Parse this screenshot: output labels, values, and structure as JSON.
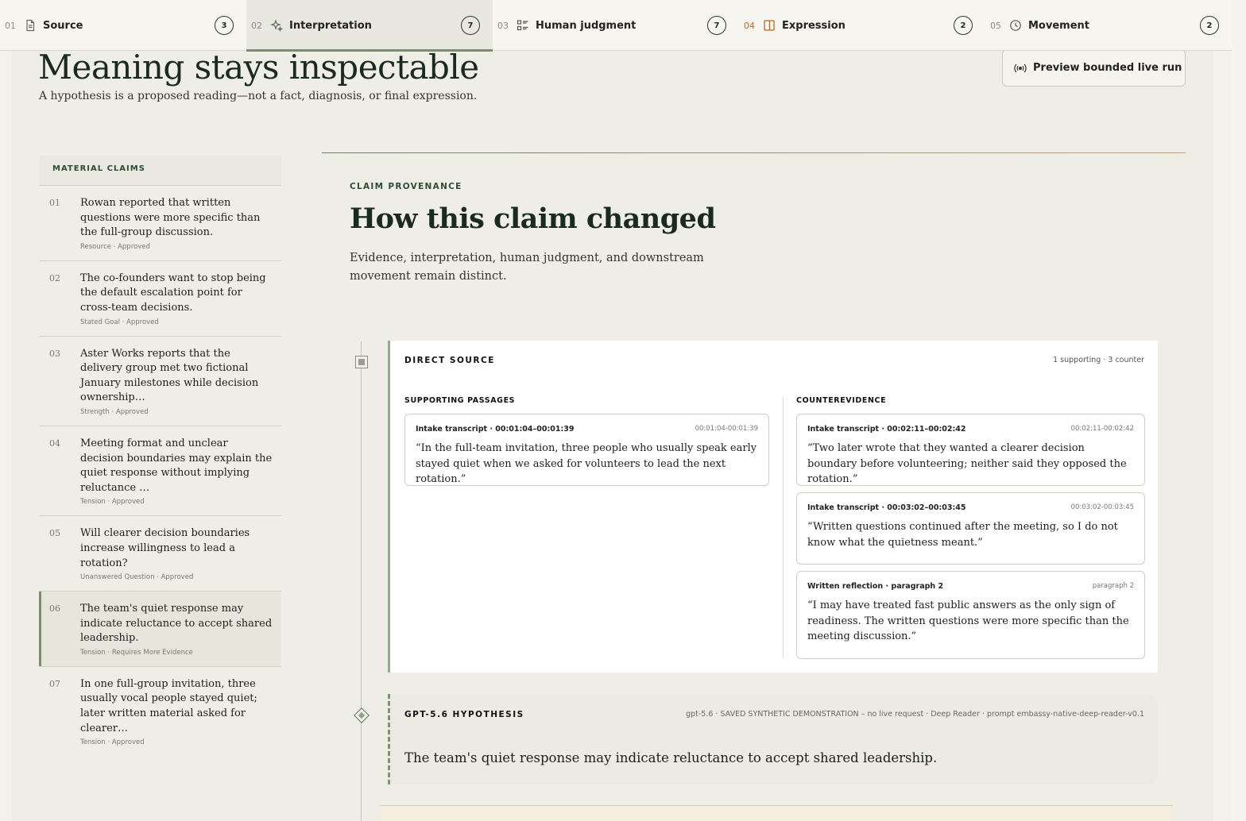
{
  "tabs": [
    {
      "num": "01",
      "label": "Source",
      "count": "3",
      "icon": "document-icon",
      "active": false
    },
    {
      "num": "02",
      "label": "Interpretation",
      "count": "7",
      "icon": "sparkle-icon",
      "active": true
    },
    {
      "num": "03",
      "label": "Human judgment",
      "count": "7",
      "icon": "checklist-icon",
      "active": false
    },
    {
      "num": "04",
      "label": "Expression",
      "count": "2",
      "icon": "panel-icon",
      "active": false
    },
    {
      "num": "05",
      "label": "Movement",
      "count": "2",
      "icon": "clock-icon",
      "active": false
    }
  ],
  "header": {
    "title": "Meaning stays inspectable",
    "subtitle": "A hypothesis is a proposed reading—not a fact, diagnosis, or final expression.",
    "preview_button": "Preview bounded live run"
  },
  "claims": {
    "heading": "MATERIAL CLAIMS",
    "items": [
      {
        "num": "01",
        "text": "Rowan reported that written questions were more specific than the full-group discussion.",
        "meta": "Resource · Approved"
      },
      {
        "num": "02",
        "text": "The co-founders want to stop being the default escalation point for cross-team decisions.",
        "meta": "Stated Goal · Approved"
      },
      {
        "num": "03",
        "text": "Aster Works reports that the delivery group met two fictional January milestones while decision ownership…",
        "meta": "Strength · Approved"
      },
      {
        "num": "04",
        "text": "Meeting format and unclear decision boundaries may explain the quiet response without implying reluctance …",
        "meta": "Tension · Approved"
      },
      {
        "num": "05",
        "text": "Will clearer decision boundaries increase willingness to lead a rotation?",
        "meta": "Unanswered Question · Approved"
      },
      {
        "num": "06",
        "text": "The team's quiet response may indicate reluctance to accept shared leadership.",
        "meta": "Tension · Requires More Evidence"
      },
      {
        "num": "07",
        "text": "In one full-group invitation, three usually vocal people stayed quiet; later written material asked for clearer…",
        "meta": "Tension · Approved"
      }
    ]
  },
  "provenance": {
    "eyebrow": "CLAIM PROVENANCE",
    "title": "How this claim changed",
    "subtitle": "Evidence, interpretation, human judgment, and downstream movement remain distinct."
  },
  "direct_source": {
    "eyebrow": "DIRECT SOURCE",
    "count": "1 supporting · 3 counter",
    "supporting_heading": "SUPPORTING PASSAGES",
    "counter_heading": "COUNTEREVIDENCE",
    "supporting": [
      {
        "source": "Intake transcript · 00:01:04–00:01:39",
        "ts": "00:01:04-00:01:39",
        "quote": "“In the full-team invitation, three people who usually speak early stayed quiet when we asked for volunteers to lead the next rotation.”"
      }
    ],
    "counter": [
      {
        "source": "Intake transcript · 00:02:11–00:02:42",
        "ts": "00:02:11-00:02:42",
        "quote": "“Two later wrote that they wanted a clearer decision boundary before volunteering; neither said they opposed the rotation.”"
      },
      {
        "source": "Intake transcript · 00:03:02–00:03:45",
        "ts": "00:03:02-00:03:45",
        "quote": "“Written questions continued after the meeting, so I do not know what the quietness meant.”"
      },
      {
        "source": "Written reflection · paragraph 2",
        "ts": "paragraph 2",
        "quote": "“I may have treated fast public answers as the only sign of readiness. The written questions were more specific than the meeting discussion.”"
      }
    ]
  },
  "hypothesis": {
    "eyebrow": "GPT-5.6 HYPOTHESIS",
    "meta": "gpt-5.6 · SAVED SYNTHETIC DEMONSTRATION – no live request · Deep Reader · prompt embassy-native-deep-reader-v0.1",
    "text": "The team's quiet response may indicate reluctance to accept shared leadership."
  }
}
